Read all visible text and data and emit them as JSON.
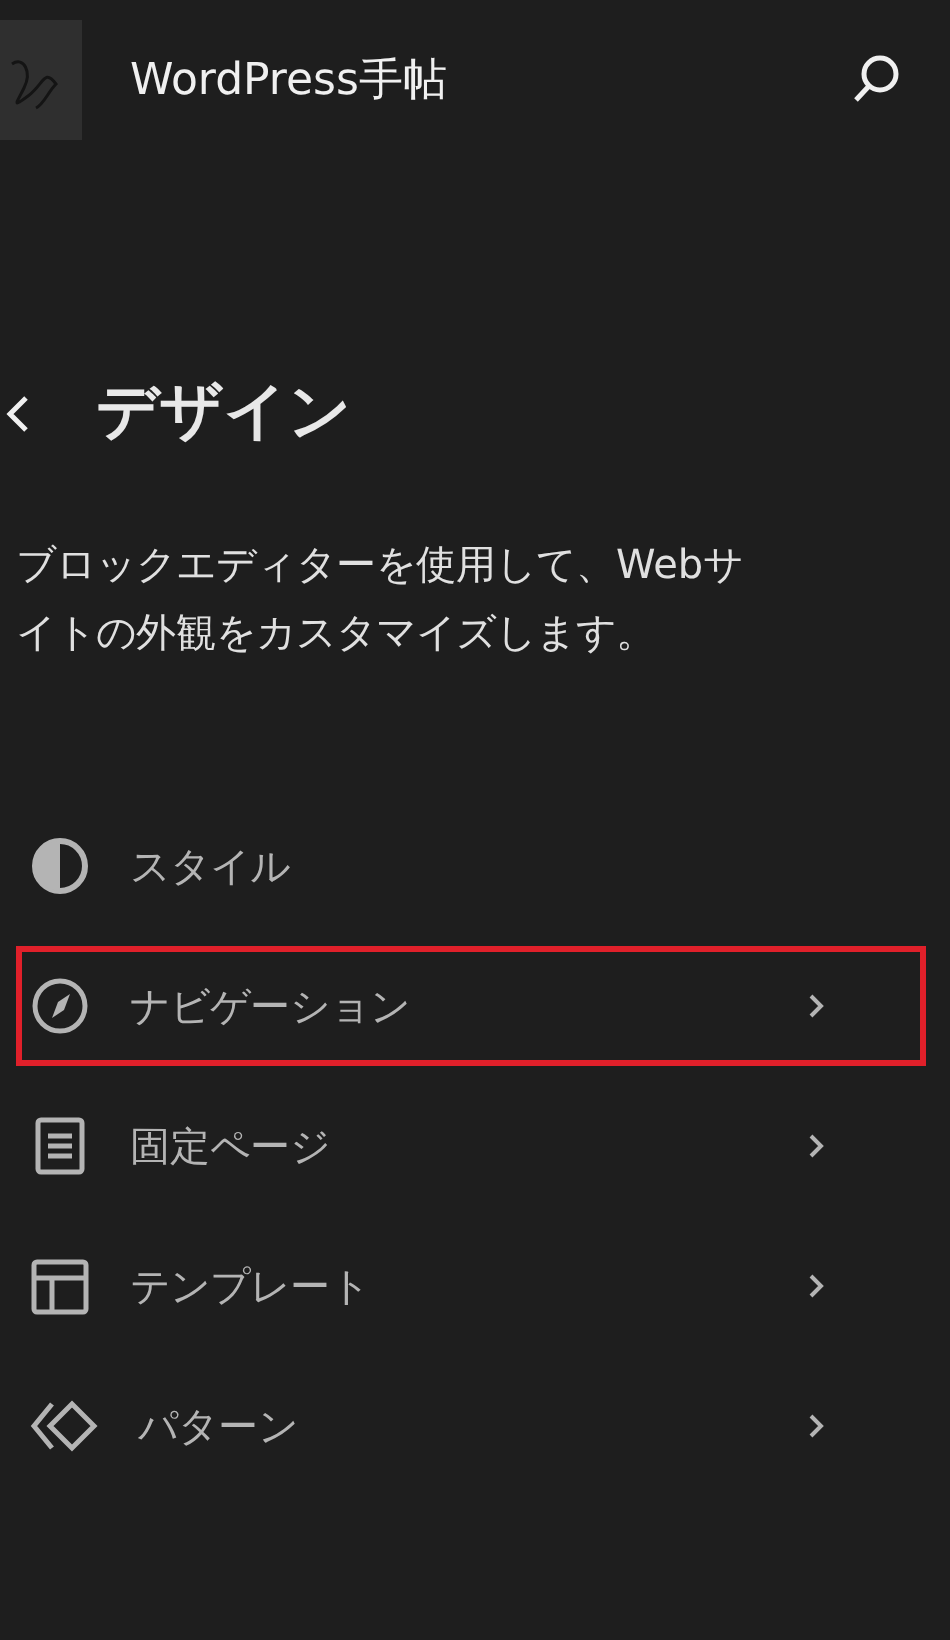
{
  "header": {
    "site_title": "WordPress手帖"
  },
  "panel": {
    "title": "デザイン",
    "description": "ブロックエディターを使用して、Webサイトの外観をカスタマイズします。"
  },
  "menu_items": [
    {
      "label": "スタイル",
      "chevron": false,
      "highlighted": false
    },
    {
      "label": "ナビゲーション",
      "chevron": true,
      "highlighted": true
    },
    {
      "label": "固定ページ",
      "chevron": true,
      "highlighted": false
    },
    {
      "label": "テンプレート",
      "chevron": true,
      "highlighted": false
    },
    {
      "label": "パターン",
      "chevron": true,
      "highlighted": false
    }
  ]
}
